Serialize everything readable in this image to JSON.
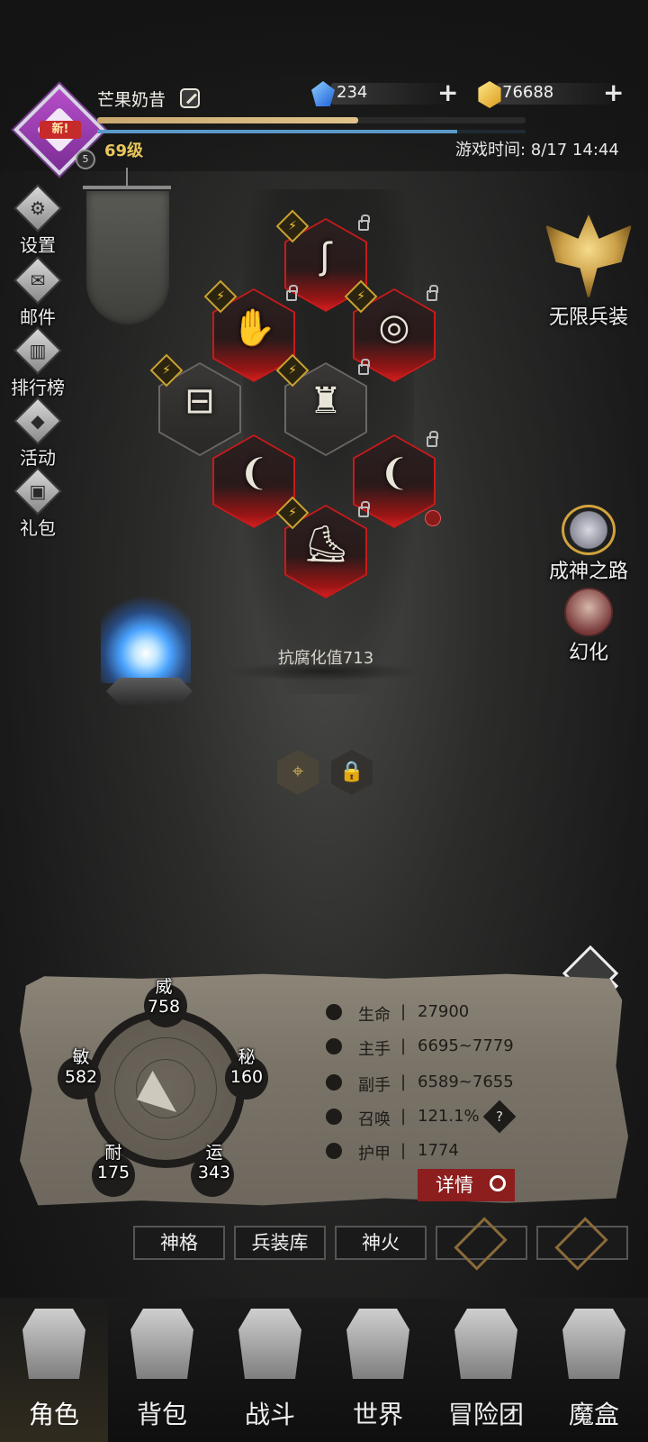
{
  "header": {
    "player_name": "芒果奶昔",
    "new_badge": "新!",
    "rank_badge": "5",
    "level": "69级",
    "xp_fraction": 0.61,
    "sub_fraction": 0.84,
    "currency": {
      "blue_gem": "234",
      "gold_gem": "76688"
    },
    "game_time": "游戏时间: 8/17 14:44",
    "plus_symbol": "+"
  },
  "side_menu": [
    {
      "label": "设置",
      "icon": "gear-icon",
      "glyph": "⚙"
    },
    {
      "label": "邮件",
      "icon": "mail-icon",
      "glyph": "✉"
    },
    {
      "label": "排行榜",
      "icon": "ranking-icon",
      "glyph": "▥"
    },
    {
      "label": "活动",
      "icon": "event-icon",
      "glyph": "◆"
    },
    {
      "label": "礼包",
      "icon": "gift-icon",
      "glyph": "▣"
    }
  ],
  "equipment": {
    "corruption_resistance": "抗腐化值713",
    "slots": [
      {
        "name": "scarf",
        "glyph": "ʃ"
      },
      {
        "name": "gauntlet",
        "glyph": "✋"
      },
      {
        "name": "ring",
        "glyph": "◎"
      },
      {
        "name": "belt",
        "glyph": "⊟"
      },
      {
        "name": "armor",
        "glyph": "♜"
      },
      {
        "name": "left-horn",
        "glyph": "❨"
      },
      {
        "name": "right-horn",
        "glyph": "❨"
      },
      {
        "name": "boots",
        "glyph": "⛸"
      }
    ],
    "lightning_glyph": "⚡",
    "pin_glyph": "⌖",
    "lock_glyph": "🔒"
  },
  "right_menu": {
    "infinite_gear": "无限兵装",
    "path_to_godhood": "成神之路",
    "transform": "幻化"
  },
  "stats": {
    "attributes": {
      "wei_label": "威",
      "wei_value": "758",
      "mi_label": "秘",
      "mi_value": "160",
      "yun_label": "运",
      "yun_value": "343",
      "nai_label": "耐",
      "nai_value": "175",
      "min_label": "敏",
      "min_value": "582"
    },
    "rows": [
      {
        "label": "生命",
        "value": "27900"
      },
      {
        "label": "主手",
        "value": "6695~7779"
      },
      {
        "label": "副手",
        "value": "6589~7655"
      },
      {
        "label": "召唤",
        "value": "121.1%"
      },
      {
        "label": "护甲",
        "value": "1774"
      }
    ],
    "separator": "|",
    "help_glyph": "?",
    "detail_button": "详情"
  },
  "tabs": [
    {
      "label": "神格",
      "locked": false
    },
    {
      "label": "兵装库",
      "locked": false
    },
    {
      "label": "神火",
      "locked": false
    },
    {
      "label": "",
      "locked": true
    },
    {
      "label": "",
      "locked": true
    }
  ],
  "bottom_nav": [
    {
      "label": "角色",
      "active": true
    },
    {
      "label": "背包",
      "active": false
    },
    {
      "label": "战斗",
      "active": false
    },
    {
      "label": "世界",
      "active": false
    },
    {
      "label": "冒险团",
      "active": false
    },
    {
      "label": "魔盒",
      "active": false
    }
  ]
}
